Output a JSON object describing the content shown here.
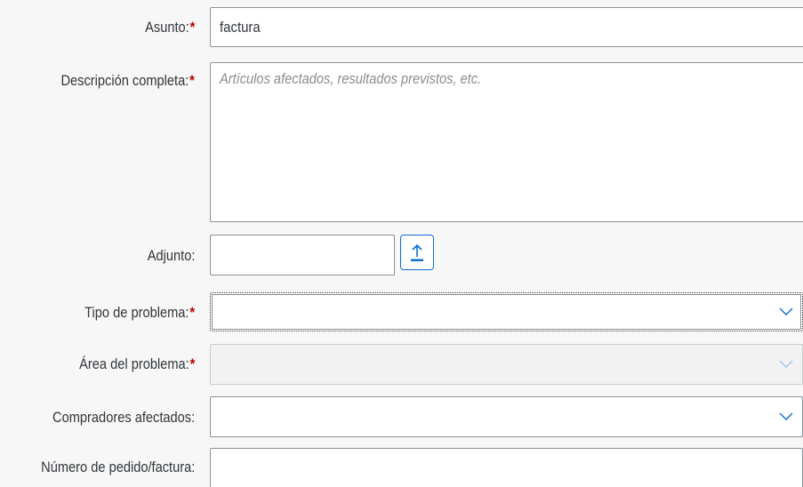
{
  "form": {
    "subject": {
      "label": "Asunto:",
      "required_mark": "*",
      "value": "factura"
    },
    "description": {
      "label": "Descripción completa:",
      "required_mark": "*",
      "placeholder": "Artículos afectados, resultados previstos, etc."
    },
    "attachment": {
      "label": "Adjunto:",
      "value": "",
      "upload_icon": "upload-icon"
    },
    "problem_type": {
      "label": "Tipo de problema:",
      "required_mark": "*",
      "value": "",
      "icon": "chevron-down-icon"
    },
    "problem_area": {
      "label": "Área del problema:",
      "required_mark": "*",
      "value": "",
      "icon": "chevron-down-icon"
    },
    "affected_buyers": {
      "label": "Compradores afectados:",
      "value": "",
      "icon": "chevron-down-icon"
    },
    "order_invoice_number": {
      "label": "Número de pedido/factura:",
      "value": ""
    }
  },
  "colors": {
    "required": "#bb0000",
    "accent": "#0a6ed1",
    "text": "#32363a",
    "placeholder": "#8c8c8c"
  }
}
